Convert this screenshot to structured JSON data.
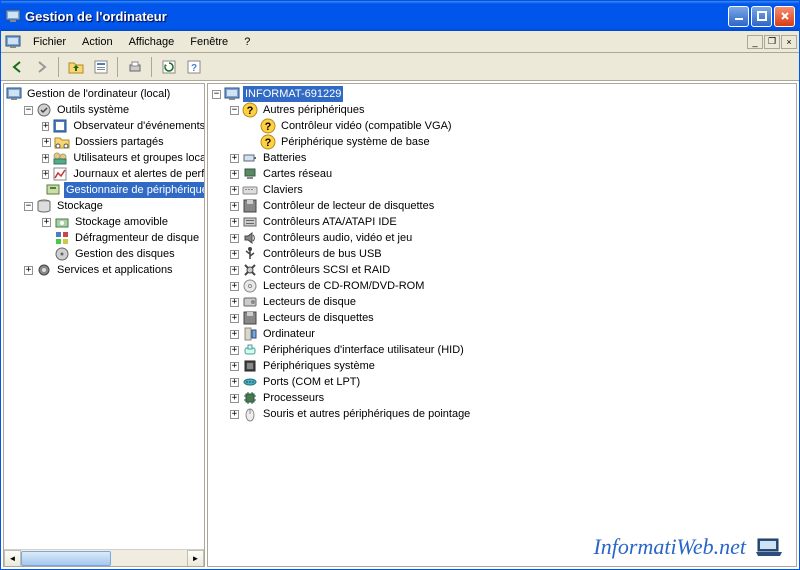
{
  "window": {
    "title": "Gestion de l'ordinateur"
  },
  "menu": {
    "file": "Fichier",
    "action": "Action",
    "view": "Affichage",
    "window": "Fenêtre",
    "help": "?"
  },
  "left_tree": {
    "root": "Gestion de l'ordinateur (local)",
    "system_tools": "Outils système",
    "event_viewer": "Observateur d'événements",
    "shared_folders": "Dossiers partagés",
    "users_groups": "Utilisateurs et groupes locaux",
    "perf_logs": "Journaux et alertes de performances",
    "device_manager": "Gestionnaire de périphériques",
    "storage": "Stockage",
    "removable_storage": "Stockage amovible",
    "defrag": "Défragmenteur de disque",
    "disk_mgmt": "Gestion des disques",
    "services_apps": "Services et applications"
  },
  "device_tree": {
    "computer": "INFORMAT-691229",
    "other_devices": "Autres périphériques",
    "video_controller": "Contrôleur vidéo (compatible VGA)",
    "base_system_device": "Périphérique système de base",
    "batteries": "Batteries",
    "network_adapters": "Cartes réseau",
    "keyboards": "Claviers",
    "floppy_controller": "Contrôleur de lecteur de disquettes",
    "ata_atapi": "Contrôleurs ATA/ATAPI IDE",
    "audio_video_game": "Contrôleurs audio, vidéo et jeu",
    "usb_controllers": "Contrôleurs de bus USB",
    "scsi_raid": "Contrôleurs SCSI et RAID",
    "dvd_cdrom": "Lecteurs de CD-ROM/DVD-ROM",
    "disk_drives": "Lecteurs de disque",
    "floppy_drives": "Lecteurs de disquettes",
    "computer_cat": "Ordinateur",
    "hid": "Périphériques d'interface utilisateur (HID)",
    "system_devices": "Périphériques système",
    "ports": "Ports (COM et LPT)",
    "processors": "Processeurs",
    "mice": "Souris et autres périphériques de pointage"
  },
  "watermark": "InformatiWeb.net"
}
